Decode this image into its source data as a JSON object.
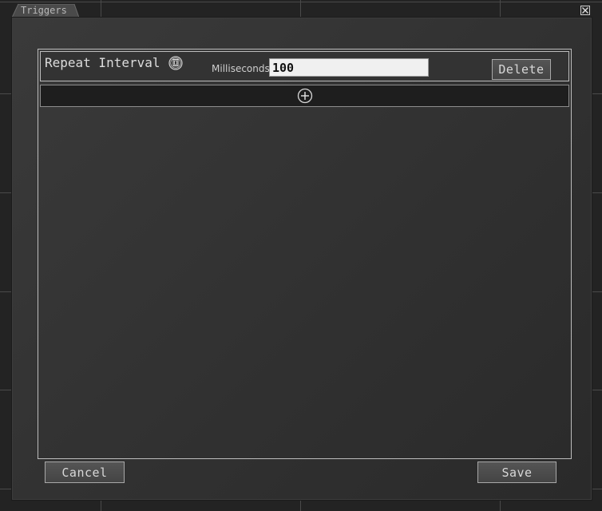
{
  "window": {
    "title": "Triggers"
  },
  "trigger": {
    "name": "Repeat Interval",
    "ms_label": "Milliseconds",
    "ms_value": "100",
    "delete_label": "Delete"
  },
  "footer": {
    "cancel_label": "Cancel",
    "save_label": "Save"
  },
  "icons": {
    "copy": "copy-icon",
    "add": "plus-circle-icon",
    "close": "close-icon"
  }
}
